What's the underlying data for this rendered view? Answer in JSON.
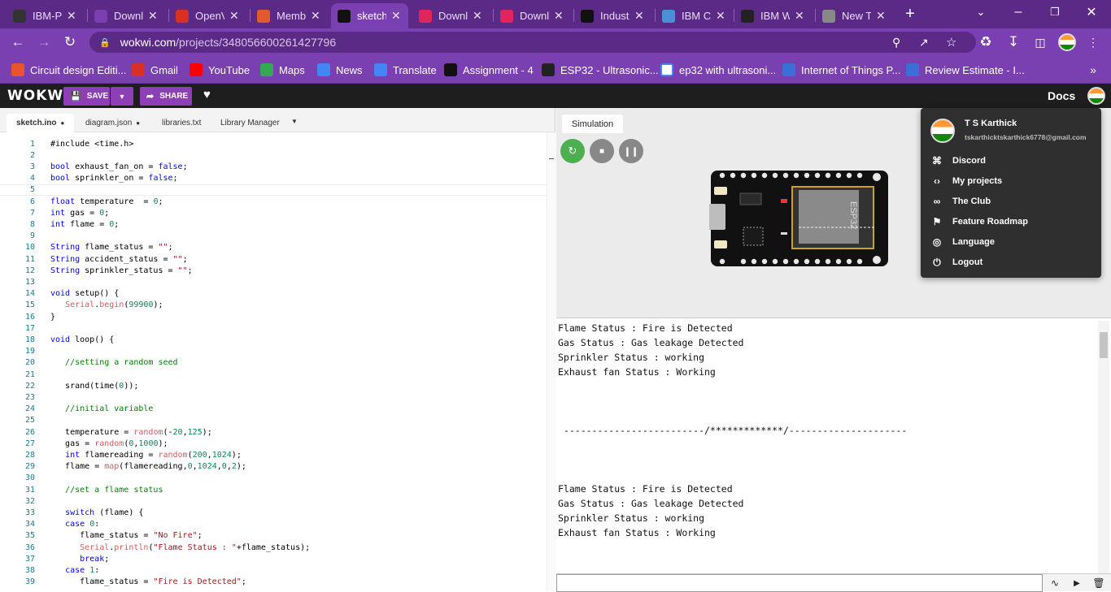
{
  "browser": {
    "tabs": [
      {
        "label": "IBM-P",
        "icon": "github-icon",
        "color": "#333333"
      },
      {
        "label": "Downl",
        "icon": "download-icon",
        "color": "#7a3fb0"
      },
      {
        "label": "OpenV",
        "icon": "gmail-icon",
        "color": "#d93025"
      },
      {
        "label": "Memb",
        "icon": "helmet-icon",
        "color": "#e05a2b"
      },
      {
        "label": "sketch",
        "icon": "wokwi-icon",
        "color": "#111111",
        "active": true
      },
      {
        "label": "Downl",
        "icon": "heart-icon",
        "color": "#e0245e"
      },
      {
        "label": "Downl",
        "icon": "heart-icon",
        "color": "#e0245e"
      },
      {
        "label": "Indust",
        "icon": "wokwi-icon",
        "color": "#111111"
      },
      {
        "label": "IBM Cl",
        "icon": "cloud-icon",
        "color": "#4a90d9"
      },
      {
        "label": "IBM W",
        "icon": "ibm-icon",
        "color": "#222222"
      },
      {
        "label": "New T",
        "icon": "chrome-icon",
        "color": "#888888"
      }
    ],
    "url_host": "wokwi.com",
    "url_path": "/projects/348056600261427796",
    "bookmarks": [
      {
        "label": "Circuit design Editi...",
        "icon": "tinkercad-icon",
        "color": "#e8542b"
      },
      {
        "label": "Gmail",
        "icon": "gmail-icon",
        "color": "#d93025"
      },
      {
        "label": "YouTube",
        "icon": "youtube-icon",
        "color": "#ff0000"
      },
      {
        "label": "Maps",
        "icon": "maps-icon",
        "color": "#34a853"
      },
      {
        "label": "News",
        "icon": "news-icon",
        "color": "#4285f4"
      },
      {
        "label": "Translate",
        "icon": "translate-icon",
        "color": "#4285f4"
      },
      {
        "label": "Assignment - 4",
        "icon": "wokwi-icon",
        "color": "#111111"
      },
      {
        "label": "ESP32 - Ultrasonic...",
        "icon": "esp32-icon",
        "color": "#222222"
      },
      {
        "label": "ep32 with ultrasoni...",
        "icon": "google-icon",
        "color": "#ffffff"
      },
      {
        "label": "Internet of Things P...",
        "icon": "iot-icon",
        "color": "#3a6fd8"
      },
      {
        "label": "Review Estimate - I...",
        "icon": "review-icon",
        "color": "#3a6fd8"
      }
    ]
  },
  "wokwi": {
    "logo": "WOKWi",
    "save_label": "SAVE",
    "share_label": "SHARE",
    "docs_label": "Docs",
    "editor_tabs": [
      "sketch.ino",
      "diagram.json",
      "libraries.txt",
      "Library Manager"
    ],
    "sim_tab": "Simulation",
    "esp_label": "ESP32"
  },
  "code_lines": [
    "#include <time.h>",
    "",
    "bool exhaust_fan_on = false;",
    "bool sprinkler_on = false;",
    "",
    "float temperature  = 0;",
    "int gas = 0;",
    "int flame = 0;",
    "",
    "String flame_status = \"\";",
    "String accident_status = \"\";",
    "String sprinkler_status = \"\";",
    "",
    "void setup() {",
    "   Serial.begin(99900);",
    "}",
    "",
    "void loop() {",
    "",
    "   //setting a random seed",
    "",
    "   srand(time(0));",
    "",
    "   //initial variable",
    "",
    "   temperature = random(-20,125);",
    "   gas = random(0,1000);",
    "   int flamereading = random(200,1024);",
    "   flame = map(flamereading,0,1024,0,2);",
    "",
    "   //set a flame status",
    "",
    "   switch (flame) {",
    "   case 0:",
    "      flame_status = \"No Fire\";",
    "      Serial.println(\"Flame Status : \"+flame_status);",
    "      break;",
    "   case 1:",
    "      flame_status = \"Fire is Detected\";"
  ],
  "serial_lines": [
    "Flame Status : Fire is Detected",
    "Gas Status : Gas leakage Detected",
    "Sprinkler Status : working",
    "Exhaust fan Status : Working",
    "",
    "",
    "",
    " -------------------------/*************/---------------------",
    "",
    "",
    "",
    "Flame Status : Fire is Detected",
    "Gas Status : Gas leakage Detected",
    "Sprinkler Status : working",
    "Exhaust fan Status : Working",
    "",
    "",
    "",
    " -------------------------/*************/---------------------"
  ],
  "user_menu": {
    "name": "T S Karthick",
    "email": "tskarthicktskarthick6778@gmail.com",
    "items": [
      {
        "label": "Discord",
        "icon": "discord-icon"
      },
      {
        "label": "My projects",
        "icon": "code-icon"
      },
      {
        "label": "The Club",
        "icon": "infinity-icon"
      },
      {
        "label": "Feature Roadmap",
        "icon": "roadmap-icon"
      },
      {
        "label": "Language",
        "icon": "globe-icon"
      },
      {
        "label": "Logout",
        "icon": "power-icon"
      }
    ]
  },
  "colors": {
    "accent": "#8e3fb5",
    "browser_frame": "#7a3fb0",
    "restart_green": "#4caf50"
  }
}
